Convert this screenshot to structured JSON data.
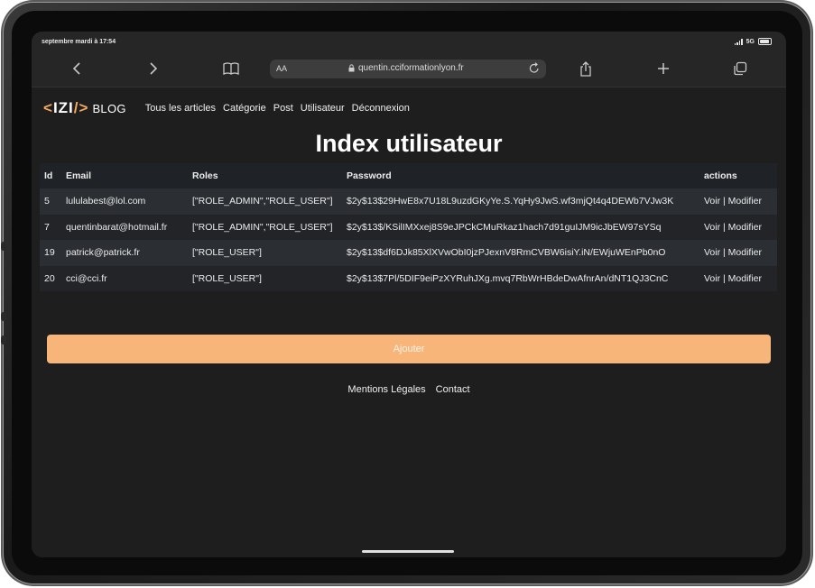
{
  "status": {
    "time": "septembre mardi à 17:54",
    "network": "5G"
  },
  "browser": {
    "text_size_label": "AA",
    "url": "quentin.cciformationlyon.fr",
    "icons": [
      "back-icon",
      "forward-icon",
      "bookmarks-icon",
      "lock-icon",
      "reload-icon",
      "share-icon",
      "plus-icon",
      "tabs-icon"
    ]
  },
  "site": {
    "logo": {
      "open": "<",
      "text": "IZI",
      "close": "/>",
      "blog": "BLOG"
    },
    "nav": [
      "Tous les articles",
      "Catégorie",
      "Post",
      "Utilisateur",
      "Déconnexion"
    ],
    "title": "Index utilisateur",
    "table": {
      "headers": [
        "Id",
        "Email",
        "Roles",
        "Password",
        "actions"
      ],
      "rows": [
        {
          "id": "5",
          "email": "lululabest@lol.com",
          "roles": "[\"ROLE_ADMIN\",\"ROLE_USER\"]",
          "password": "$2y$13$29HwE8x7U18L9uzdGKyYe.S.YqHy9JwS.wf3mjQt4q4DEWb7VJw3K",
          "view": "Voir",
          "sep": "|",
          "edit": "Modifier"
        },
        {
          "id": "7",
          "email": "quentinbarat@hotmail.fr",
          "roles": "[\"ROLE_ADMIN\",\"ROLE_USER\"]",
          "password": "$2y$13$/KSilIMXxej8S9eJPCkCMuRkaz1hach7d91guIJM9icJbEW97sYSq",
          "view": "Voir",
          "sep": "|",
          "edit": "Modifier"
        },
        {
          "id": "19",
          "email": "patrick@patrick.fr",
          "roles": "[\"ROLE_USER\"]",
          "password": "$2y$13$df6DJk85XlXVwObI0jzPJexnV8RmCVBW6isiY.iN/EWjuWEnPb0nO",
          "view": "Voir",
          "sep": "|",
          "edit": "Modifier"
        },
        {
          "id": "20",
          "email": "cci@cci.fr",
          "roles": "[\"ROLE_USER\"]",
          "password": "$2y$13$7Pl/5DIF9eiPzXYRuhJXg.mvq7RbWrHBdeDwAfnrAn/dNT1QJ3CnC",
          "view": "Voir",
          "sep": "|",
          "edit": "Modifier"
        }
      ]
    },
    "add_button": "Ajouter",
    "footer": [
      "Mentions Légales",
      "Contact"
    ]
  },
  "colors": {
    "accent": "#f7b57a",
    "background": "#1e1e1e",
    "row_odd": "#2b2e33",
    "row_even": "#222428"
  }
}
